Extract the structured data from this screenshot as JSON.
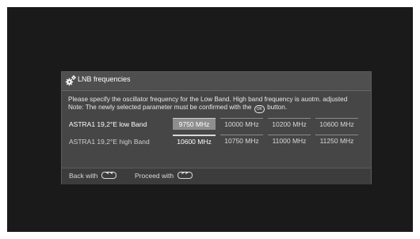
{
  "dialog": {
    "title": "LNB frequencies",
    "icon": "gear-icon",
    "description_line1": "Please specify the oscillator frequency for the Low Band. High band frequency is auotm. adjusted",
    "description_line2_before": "Note: The newly selected parameter must be confirmed with the",
    "ok_symbol": "OK",
    "description_line2_after": "button."
  },
  "rows": [
    {
      "label": "ASTRA1 19,2°E low Band",
      "options": [
        "9750 MHz",
        "10000 MHz",
        "10200 MHz",
        "10600 MHz"
      ],
      "selected": "9750 MHz"
    },
    {
      "label": "ASTRA1 19,2°E high Band",
      "options": [
        "10600 MHz",
        "10750 MHz",
        "11000 MHz",
        "11250 MHz"
      ],
      "selected": "10600 MHz"
    }
  ],
  "footer": {
    "back_label": "Back with",
    "back_key": "◄◄",
    "proceed_label": "Proceed with",
    "proceed_key": "►►"
  },
  "colors": {
    "screen_bg": "#1a1a1a",
    "dialog_bg": "#4a4a4a",
    "selected_bg": "#8e8e8e"
  }
}
